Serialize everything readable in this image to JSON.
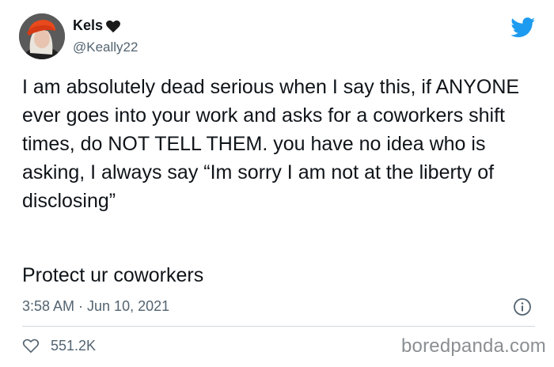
{
  "author": {
    "display_name": "Kels",
    "handle": "@Keally22",
    "name_emoji": "black-heart-icon"
  },
  "tweet": {
    "text": "I am absolutely dead serious when I say this, if ANYONE ever goes into your work and asks for a coworkers shift times, do NOT TELL THEM. you have no idea who is asking, I always say “Im sorry I am not at the liberty of disclosing”",
    "text_line_2": "Protect ur coworkers",
    "timestamp": "3:58 AM · Jun 10, 2021"
  },
  "stats": {
    "likes": "551.2K"
  },
  "watermark": "boredpanda.com",
  "colors": {
    "twitter_blue": "#1d9bf0",
    "secondary_text": "#536471",
    "text": "#0f1419"
  }
}
